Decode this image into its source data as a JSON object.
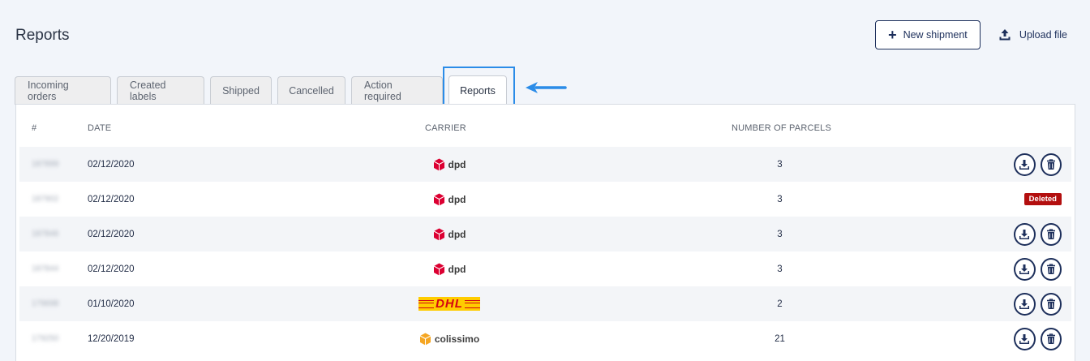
{
  "page": {
    "title": "Reports"
  },
  "header": {
    "new_shipment_label": "New shipment",
    "upload_file_label": "Upload file"
  },
  "tabs": [
    {
      "label": "Incoming orders",
      "active": false
    },
    {
      "label": "Created labels",
      "active": false
    },
    {
      "label": "Shipped",
      "active": false
    },
    {
      "label": "Cancelled",
      "active": false
    },
    {
      "label": "Action required",
      "active": false
    },
    {
      "label": "Reports",
      "active": true
    }
  ],
  "table": {
    "columns": {
      "id": "#",
      "date": "DATE",
      "carrier": "CARRIER",
      "parcels": "NUMBER OF PARCELS"
    },
    "rows": [
      {
        "id": "187899",
        "date": "02/12/2020",
        "carrier": "dpd",
        "parcels": "3",
        "status": "active"
      },
      {
        "id": "187902",
        "date": "02/12/2020",
        "carrier": "dpd",
        "parcels": "3",
        "status": "deleted"
      },
      {
        "id": "187846",
        "date": "02/12/2020",
        "carrier": "dpd",
        "parcels": "3",
        "status": "active"
      },
      {
        "id": "187844",
        "date": "02/12/2020",
        "carrier": "dpd",
        "parcels": "3",
        "status": "active"
      },
      {
        "id": "179698",
        "date": "01/10/2020",
        "carrier": "DHL",
        "parcels": "2",
        "status": "active"
      },
      {
        "id": "179250",
        "date": "12/20/2019",
        "carrier": "colissimo",
        "parcels": "21",
        "status": "active"
      }
    ],
    "deleted_label": "Deleted"
  },
  "icons": {
    "new_shipment": "plus-icon",
    "upload": "upload-icon",
    "download": "download-icon",
    "delete": "trash-icon",
    "annotation": "arrow-left-icon"
  },
  "colors": {
    "primary": "#1d2f5b",
    "highlight": "#2b8ce8",
    "deleted": "#b30f0f",
    "dpd": "#dc0032",
    "dhl_yellow": "#ffcc00",
    "dhl_red": "#d40511",
    "colissimo": "#f5a623"
  }
}
